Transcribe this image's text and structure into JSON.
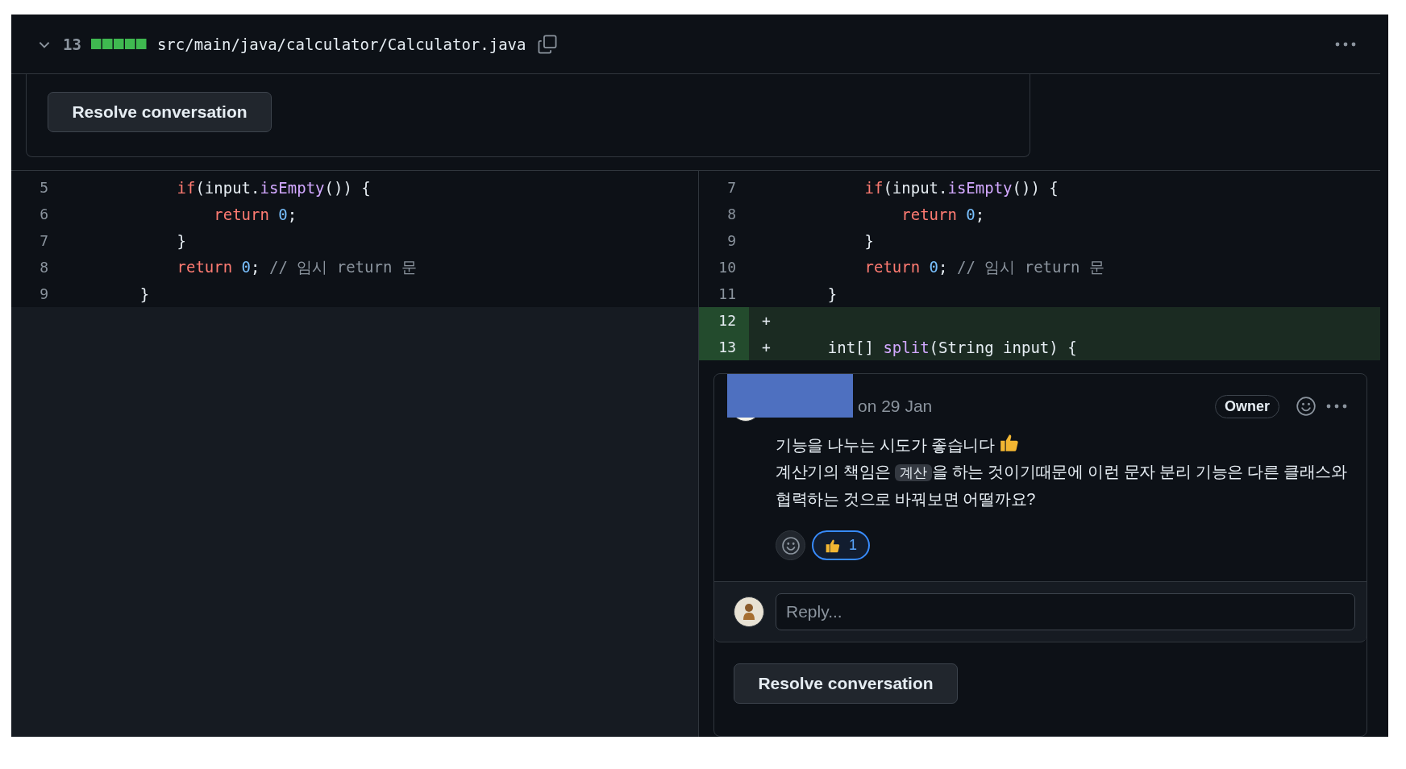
{
  "file_header": {
    "expanded": true,
    "changes": "13",
    "path": "src/main/java/calculator/Calculator.java"
  },
  "previous_thread": {
    "resolve_button": "Resolve conversation"
  },
  "diff": {
    "left": [
      {
        "number": "5",
        "added": false,
        "tokens": [
          {
            "kind": "keyword",
            "text": "        if"
          },
          {
            "kind": "plain",
            "text": "(input."
          },
          {
            "kind": "func",
            "text": "isEmpty"
          },
          {
            "kind": "plain",
            "text": "()) {"
          }
        ]
      },
      {
        "number": "6",
        "added": false,
        "tokens": [
          {
            "kind": "keyword",
            "text": "            return"
          },
          {
            "kind": "number",
            "text": " 0"
          },
          {
            "kind": "plain",
            "text": ";"
          }
        ]
      },
      {
        "number": "7",
        "added": false,
        "tokens": [
          {
            "kind": "plain",
            "text": "        }"
          }
        ]
      },
      {
        "number": "8",
        "added": false,
        "tokens": [
          {
            "kind": "keyword",
            "text": "        return"
          },
          {
            "kind": "number",
            "text": " 0"
          },
          {
            "kind": "plain",
            "text": ";"
          },
          {
            "kind": "comment",
            "text": " // 임시 return 문"
          }
        ]
      },
      {
        "number": "9",
        "added": false,
        "tokens": [
          {
            "kind": "plain",
            "text": "    }"
          }
        ]
      }
    ],
    "right": [
      {
        "number": "7",
        "added": false,
        "tokens": [
          {
            "kind": "keyword",
            "text": "        if"
          },
          {
            "kind": "plain",
            "text": "(input."
          },
          {
            "kind": "func",
            "text": "isEmpty"
          },
          {
            "kind": "plain",
            "text": "()) {"
          }
        ]
      },
      {
        "number": "8",
        "added": false,
        "tokens": [
          {
            "kind": "keyword",
            "text": "            return"
          },
          {
            "kind": "number",
            "text": " 0"
          },
          {
            "kind": "plain",
            "text": ";"
          }
        ]
      },
      {
        "number": "9",
        "added": false,
        "tokens": [
          {
            "kind": "plain",
            "text": "        }"
          }
        ]
      },
      {
        "number": "10",
        "added": false,
        "tokens": [
          {
            "kind": "keyword",
            "text": "        return"
          },
          {
            "kind": "number",
            "text": " 0"
          },
          {
            "kind": "plain",
            "text": ";"
          },
          {
            "kind": "comment",
            "text": " // 임시 return 문"
          }
        ]
      },
      {
        "number": "11",
        "added": false,
        "tokens": [
          {
            "kind": "plain",
            "text": "    }"
          }
        ]
      },
      {
        "number": "12",
        "added": true,
        "marker": "+"
      },
      {
        "number": "13",
        "added": true,
        "marker": "+",
        "tokens": [
          {
            "kind": "plain",
            "text": "    int[] "
          },
          {
            "kind": "func",
            "text": "split"
          },
          {
            "kind": "plain",
            "text": "(String input) {"
          }
        ]
      }
    ]
  },
  "comment": {
    "date": "on 29 Jan",
    "badge": "Owner",
    "paragraphs": [
      [
        {
          "kind": "text",
          "text": "기능을 나누는 시도가 좋습니다"
        },
        {
          "kind": "thumbs_up"
        }
      ],
      [
        {
          "kind": "text",
          "text": "계산기의 책임은 "
        },
        {
          "kind": "code",
          "text": "계산"
        },
        {
          "kind": "text",
          "text": "을 하는 것이기때문에 이런 문자 분리 기능은 다른 클래스와 협력하는 것으로 바꿔보면 어떨까요?"
        }
      ]
    ],
    "reactions": [
      {
        "count": "1",
        "selected": true
      }
    ],
    "reply": {
      "placeholder": "Reply..."
    },
    "resolve_button": "Resolve conversation"
  }
}
